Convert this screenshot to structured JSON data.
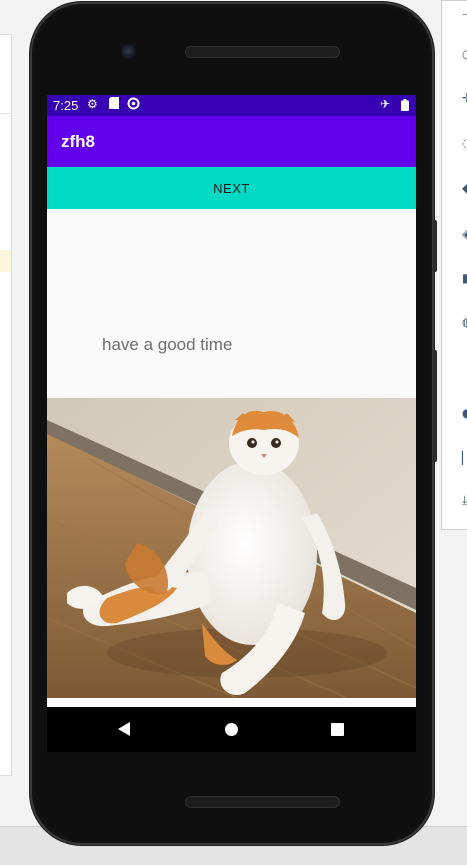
{
  "status_bar": {
    "time": "7:25",
    "icons": [
      "settings-icon",
      "sd-card-icon",
      "sync-icon",
      "airplane-mode-icon",
      "battery-icon"
    ]
  },
  "app_bar": {
    "title": "zfh8"
  },
  "main": {
    "next_button_label": "NEXT",
    "message": "have a good time",
    "image_subject": "cat-photo"
  },
  "colors": {
    "status_bar": "#3700b3",
    "app_bar": "#6200ee",
    "button": "#03dac5",
    "screen_background": "#fafafa"
  }
}
